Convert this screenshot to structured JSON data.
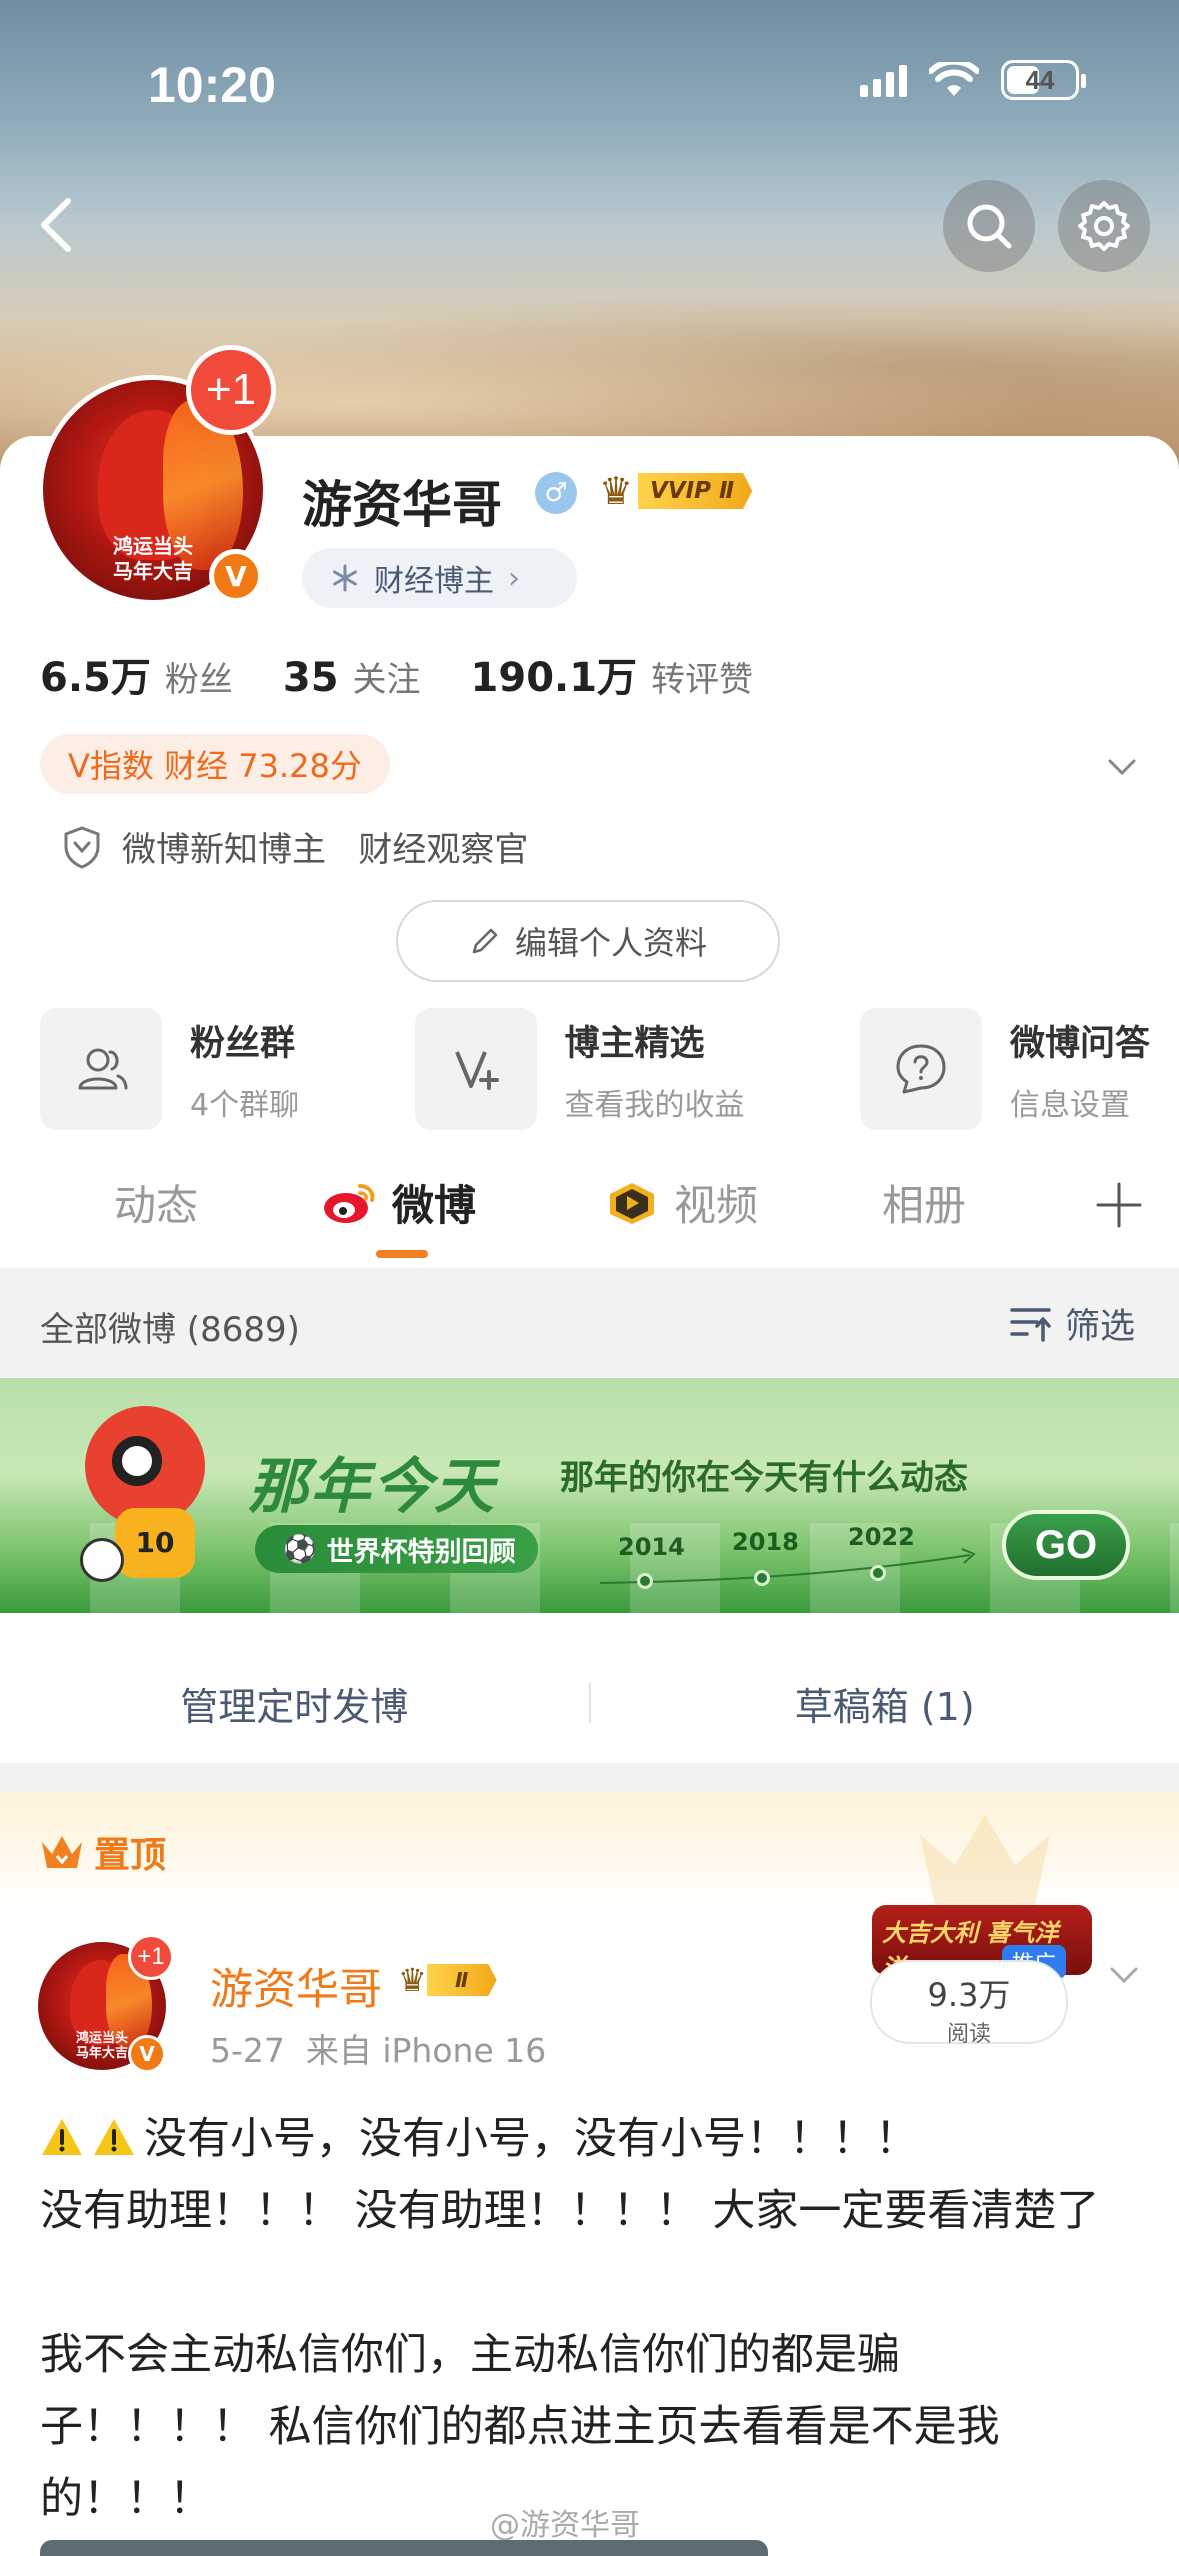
{
  "status_bar": {
    "time": "10:20",
    "battery": "44"
  },
  "profile": {
    "name": "游资华哥",
    "vip_label": "VVIP Ⅱ",
    "category": "财经博主",
    "avatar_caption_line1": "鸿运当头",
    "avatar_caption_line2": "马年大吉",
    "plus_badge": "+1",
    "v_badge": "V",
    "stats": [
      {
        "value": "6.5万",
        "label": "粉丝"
      },
      {
        "value": "35",
        "label": "关注"
      },
      {
        "value": "190.1万",
        "label": "转评赞"
      }
    ],
    "v_index": "V指数 财经 73.28分",
    "verification": "微博新知博主   财经观察官",
    "edit_button": "编辑个人资料"
  },
  "tools": [
    {
      "title": "粉丝群",
      "subtitle": "4个群聊",
      "icon": "fans-group-icon"
    },
    {
      "title": "博主精选",
      "subtitle": "查看我的收益",
      "icon": "v-plus-icon"
    },
    {
      "title": "微博问答",
      "subtitle": "信息设置",
      "icon": "question-icon"
    }
  ],
  "tabs": [
    {
      "label": "动态",
      "active": false
    },
    {
      "label": "微博",
      "active": true
    },
    {
      "label": "视频",
      "active": false
    },
    {
      "label": "相册",
      "active": false
    }
  ],
  "feed_header": {
    "all_posts": "全部微博 (8689)",
    "filter": "筛选"
  },
  "banner": {
    "title": "那年今天",
    "subtitle": "那年的你在今天有什么动态",
    "pill": "世界杯特别回顾",
    "years": [
      "2014",
      "2018",
      "2022"
    ],
    "go": "GO",
    "jersey_number": "10"
  },
  "manage": {
    "scheduled": "管理定时发博",
    "drafts": "草稿箱 (1)"
  },
  "pinned_label": "置顶",
  "post": {
    "author": "游资华哥",
    "vip_label": "Ⅱ",
    "meta": "5-27  来自 iPhone 16",
    "avatar_caption_line1": "鸿运当头",
    "avatar_caption_line2": "马年大吉",
    "plus_badge": "+1",
    "v_badge": "V",
    "promo_text": "大吉大利 喜气洋洋",
    "promo_tag": "推广",
    "reads_value": "9.3万",
    "reads_label": "阅读",
    "line1": "没有小号，没有小号，没有小号！！！！",
    "line2": "没有助理！！！ 没有助理！！！！ 大家一定要看清楚了",
    "line3": "我不会主动私信你们，主动私信你们的都是骗",
    "line4": "子！！！！ 私信你们的都点进主页去看看是不是我",
    "line5": "的！！！"
  },
  "watermark": "@游资华哥",
  "colors": {
    "accent_orange": "#f07a1a",
    "link_blue": "#4b5a73",
    "vindex_bg": "#fdeee5"
  }
}
